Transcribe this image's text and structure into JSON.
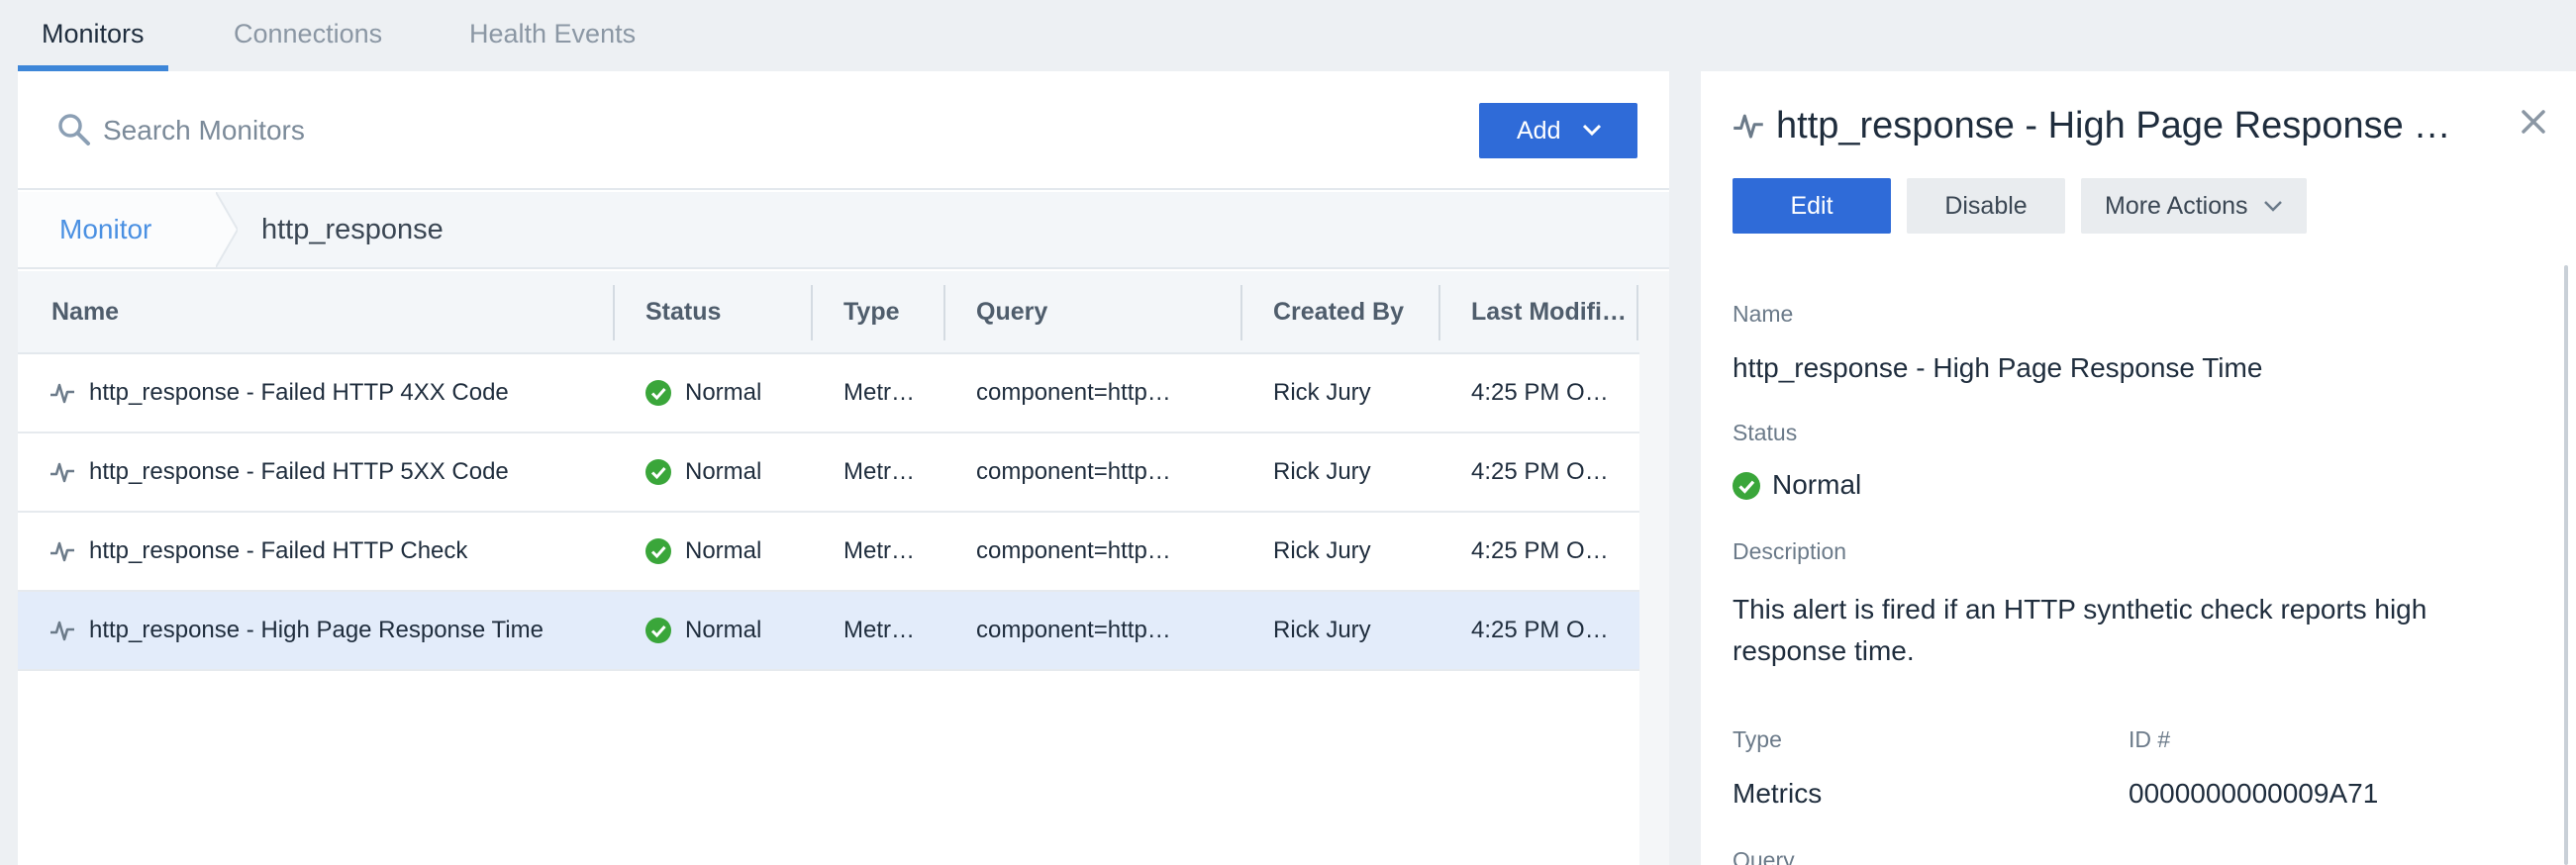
{
  "tabs": [
    {
      "label": "Monitors",
      "active": true
    },
    {
      "label": "Connections",
      "active": false
    },
    {
      "label": "Health Events",
      "active": false
    }
  ],
  "search": {
    "placeholder": "Search Monitors",
    "value": ""
  },
  "toolbar": {
    "add_label": "Add"
  },
  "breadcrumb": {
    "root": "Monitor",
    "current": "http_response"
  },
  "table": {
    "columns": [
      "Name",
      "Status",
      "Type",
      "Query",
      "Created By",
      "Last Modifi…"
    ],
    "rows": [
      {
        "name": "http_response - Failed HTTP 4XX Code",
        "status": "Normal",
        "type": "Metr…",
        "query": "component=http…",
        "created_by": "Rick Jury",
        "last_modified": "4:25 PM O…",
        "selected": false
      },
      {
        "name": "http_response - Failed HTTP 5XX Code",
        "status": "Normal",
        "type": "Metr…",
        "query": "component=http…",
        "created_by": "Rick Jury",
        "last_modified": "4:25 PM O…",
        "selected": false
      },
      {
        "name": "http_response - Failed HTTP Check",
        "status": "Normal",
        "type": "Metr…",
        "query": "component=http…",
        "created_by": "Rick Jury",
        "last_modified": "4:25 PM O…",
        "selected": false
      },
      {
        "name": "http_response - High Page Response Time",
        "status": "Normal",
        "type": "Metr…",
        "query": "component=http…",
        "created_by": "Rick Jury",
        "last_modified": "4:25 PM O…",
        "selected": true
      }
    ]
  },
  "detail": {
    "title": "http_response - High Page Response T…",
    "buttons": {
      "edit": "Edit",
      "disable": "Disable",
      "more": "More Actions"
    },
    "fields": {
      "name_label": "Name",
      "name_value": "http_response - High Page Response Time",
      "status_label": "Status",
      "status_value": "Normal",
      "description_label": "Description",
      "description_value": "This alert is fired if an HTTP synthetic check reports high response time.",
      "type_label": "Type",
      "type_value": "Metrics",
      "id_label": "ID #",
      "id_value": "0000000000009A71",
      "query_label": "Query"
    }
  },
  "colors": {
    "accent": "#2f6bd8",
    "tab_underline": "#3d86d8",
    "status_ok": "#3aa63a",
    "selected_row": "#e3ecfa",
    "link": "#4a90e2"
  },
  "icons": {
    "search": "search-icon",
    "monitor": "pulse-icon",
    "status": "check-circle-icon",
    "close": "close-icon",
    "dropdown": "chevron-down-icon"
  }
}
